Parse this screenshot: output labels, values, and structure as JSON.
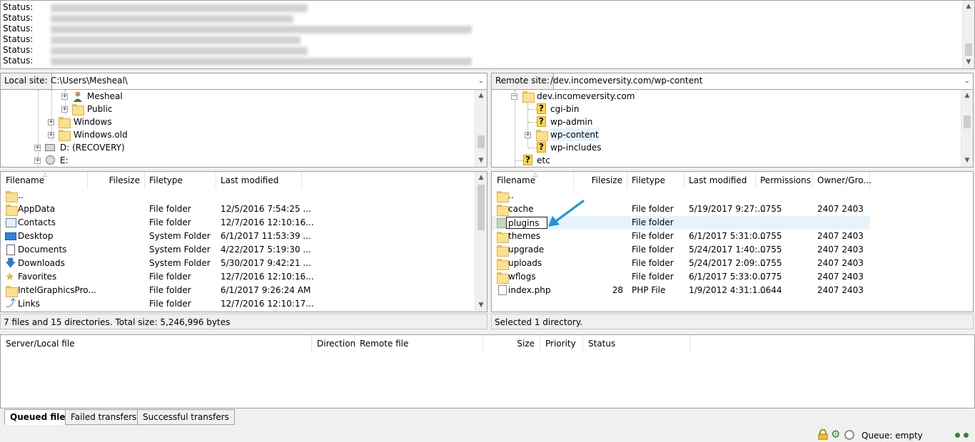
{
  "message_log": {
    "rows": [
      "Status:",
      "Status:",
      "Status:",
      "Status:",
      "Status:",
      "Status:"
    ]
  },
  "local": {
    "site_label": "Local site:",
    "site_path": "C:\\Users\\Mesheal\\",
    "tree": [
      "Mesheal",
      "Public",
      "Windows",
      "Windows.old",
      "D: (RECOVERY)",
      "E:"
    ],
    "columns": [
      "Filename",
      "Filesize",
      "Filetype",
      "Last modified"
    ],
    "files": [
      {
        "name": "..",
        "size": "",
        "type": "",
        "modified": "",
        "icon": "folder-icon"
      },
      {
        "name": "AppData",
        "size": "",
        "type": "File folder",
        "modified": "12/5/2016 7:54:25 ...",
        "icon": "folder-icon"
      },
      {
        "name": "Contacts",
        "size": "",
        "type": "File folder",
        "modified": "12/7/2016 12:10:16...",
        "icon": "contacts-icon"
      },
      {
        "name": "Desktop",
        "size": "",
        "type": "System Folder",
        "modified": "6/1/2017 11:53:39 ...",
        "icon": "desktop-icon"
      },
      {
        "name": "Documents",
        "size": "",
        "type": "System Folder",
        "modified": "4/22/2017 5:19:30 ...",
        "icon": "documents-icon"
      },
      {
        "name": "Downloads",
        "size": "",
        "type": "System Folder",
        "modified": "5/30/2017 9:42:21 ...",
        "icon": "downloads-icon"
      },
      {
        "name": "Favorites",
        "size": "",
        "type": "File folder",
        "modified": "12/7/2016 12:10:16...",
        "icon": "favorites-star-icon"
      },
      {
        "name": "IntelGraphicsPro...",
        "size": "",
        "type": "File folder",
        "modified": "6/1/2017 9:26:24 AM",
        "icon": "folder-icon"
      },
      {
        "name": "Links",
        "size": "",
        "type": "File folder",
        "modified": "12/7/2016 12:10:17...",
        "icon": "links-icon"
      }
    ],
    "status": "7 files and 15 directories. Total size: 5,246,996 bytes"
  },
  "remote": {
    "site_label": "Remote site:",
    "site_path": "/dev.incomeversity.com/wp-content",
    "tree": [
      "dev.incomeversity.com",
      "cgi-bin",
      "wp-admin",
      "wp-content",
      "wp-includes",
      "etc"
    ],
    "columns": [
      "Filename",
      "Filesize",
      "Filetype",
      "Last modified",
      "Permissions",
      "Owner/Gro..."
    ],
    "files": [
      {
        "name": "..",
        "size": "",
        "type": "",
        "modified": "",
        "perms": "",
        "owner": ""
      },
      {
        "name": "cache",
        "size": "",
        "type": "File folder",
        "modified": "5/19/2017 9:27:...",
        "perms": "0755",
        "owner": "2407 2403"
      },
      {
        "name": "plugins",
        "size": "",
        "type": "File folder",
        "modified": "",
        "perms": "",
        "owner": ""
      },
      {
        "name": "themes",
        "size": "",
        "type": "File folder",
        "modified": "6/1/2017 5:31:0...",
        "perms": "0755",
        "owner": "2407 2403"
      },
      {
        "name": "upgrade",
        "size": "",
        "type": "File folder",
        "modified": "5/24/2017 1:40:...",
        "perms": "0755",
        "owner": "2407 2403"
      },
      {
        "name": "uploads",
        "size": "",
        "type": "File folder",
        "modified": "5/24/2017 2:09:...",
        "perms": "0755",
        "owner": "2407 2403"
      },
      {
        "name": "wflogs",
        "size": "",
        "type": "File folder",
        "modified": "6/1/2017 5:33:0...",
        "perms": "0775",
        "owner": "2407 2403"
      },
      {
        "name": "index.php",
        "size": "28",
        "type": "PHP File",
        "modified": "1/9/2012 4:31:1...",
        "perms": "0644",
        "owner": "2407 2403"
      }
    ],
    "status": "Selected 1 directory."
  },
  "queue": {
    "columns": [
      "Server/Local file",
      "Direction",
      "Remote file",
      "Size",
      "Priority",
      "Status"
    ],
    "tabs": [
      "Queued files",
      "Failed transfers",
      "Successful transfers"
    ]
  },
  "statusbar": {
    "queue_text": "Queue: empty"
  },
  "colors": {
    "accent_arrow": "#1e90e6",
    "folder": "#fbe08f",
    "unknown_folder": "#ffd54f",
    "led": "#3a7d3a"
  }
}
